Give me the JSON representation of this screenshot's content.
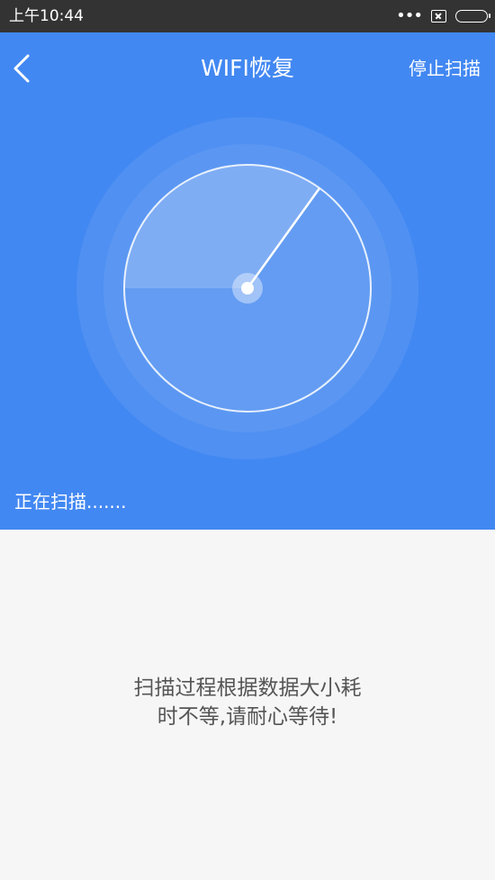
{
  "status_bar": {
    "time": "上午10:44",
    "icons": [
      "more-dots-icon",
      "close-box-icon",
      "battery-icon"
    ]
  },
  "header": {
    "back_icon": "chevron-left-icon",
    "title": "WIFI恢复",
    "stop_label": "停止扫描"
  },
  "scan": {
    "status_text": "正在扫描......."
  },
  "message": {
    "line1": "扫描过程根据数据大小耗",
    "line2": "时不等,请耐心等待!"
  },
  "colors": {
    "primary": "#4288f2",
    "status_bar": "#333333",
    "background": "#f6f6f6",
    "message_text": "#555555"
  }
}
